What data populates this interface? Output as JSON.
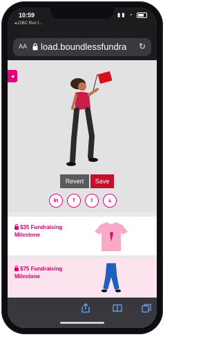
{
  "status_bar": {
    "time": "10:59",
    "back_app": "◂ CIBC Run f..."
  },
  "browser": {
    "aa_label": "AA",
    "url": "load.boundlessfundra"
  },
  "page": {
    "side_tab_glyph": "◂",
    "buttons": {
      "revert": "Revert",
      "save": "Save"
    },
    "share": [
      {
        "label": "in",
        "icon": "linkedin-icon"
      },
      {
        "label": "f",
        "icon": "facebook-icon"
      },
      {
        "label": "t",
        "icon": "twitter-icon"
      },
      {
        "label": "⤓",
        "icon": "download-icon"
      }
    ],
    "milestones": [
      {
        "label": "$35 Fundraising Milestone",
        "icon": "tshirt-image"
      },
      {
        "label": "$75 Fundraising Milestone",
        "icon": "pants-image"
      }
    ]
  },
  "colors": {
    "accent": "#e6007e",
    "save": "#c8102e",
    "revert": "#5a5a5c"
  }
}
